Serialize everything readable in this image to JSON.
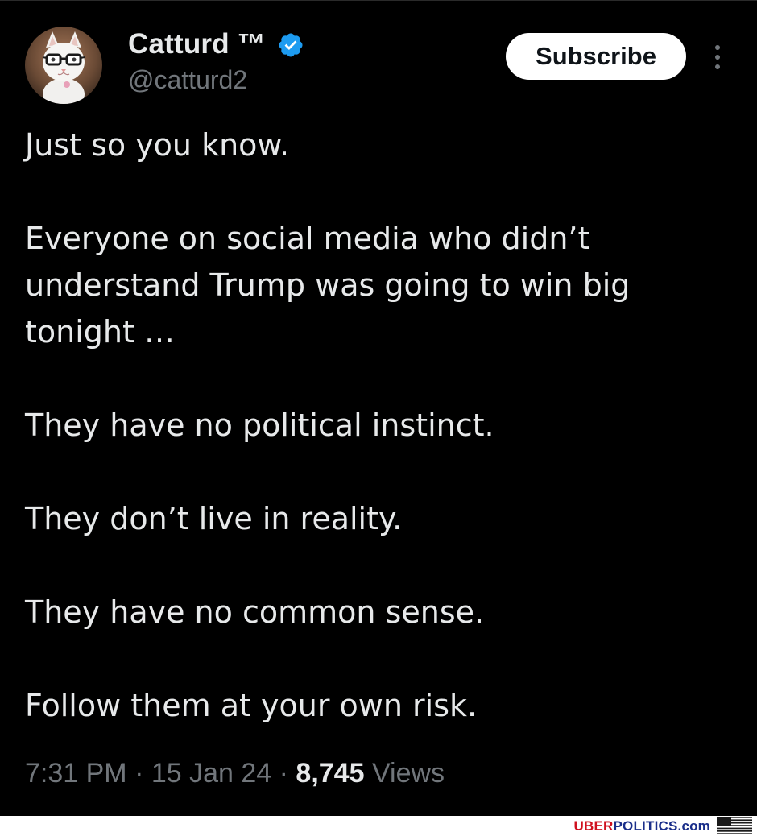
{
  "author": {
    "display_name": "Catturd ™",
    "handle": "@catturd2"
  },
  "actions": {
    "subscribe_label": "Subscribe"
  },
  "tweet": {
    "paragraphs": [
      "Just so you know.",
      "Everyone on social media who didn’t understand Trump was going to win big tonight …",
      "They have no political instinct.",
      "They don’t live in reality.",
      "They have no common sense.",
      "Follow them at your own risk."
    ]
  },
  "meta": {
    "time": "7:31 PM",
    "separator": " · ",
    "date": "15 Jan 24",
    "views_count": "8,745",
    "views_label": " Views"
  },
  "watermark": {
    "uber": "UBER",
    "politics": "POLITICS",
    "domain": ".com"
  },
  "colors": {
    "background": "#000000",
    "text_primary": "#e7e9ea",
    "text_secondary": "#71767b",
    "verified_badge": "#1d9bf0",
    "watermark_red": "#d0101e",
    "watermark_blue": "#1a2e8a"
  },
  "icons": {
    "verified": "verified-badge-icon",
    "more": "more-vertical-icon",
    "flag": "us-flag-icon"
  }
}
